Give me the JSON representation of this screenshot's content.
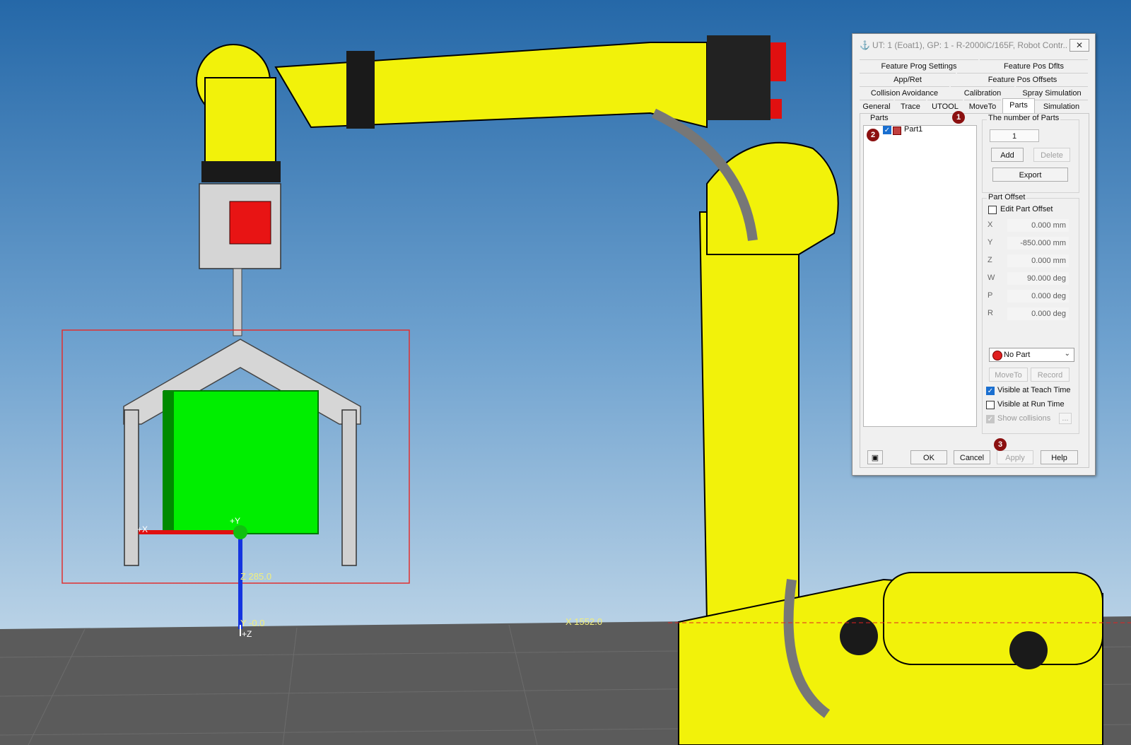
{
  "scene": {
    "labels": {
      "z_dim": "Z 285.0",
      "y_dim": "Y -0.0",
      "x_dim": "X 1552.0",
      "axis_plus_y": "+Y",
      "axis_plus_x": "+X",
      "axis_plus_z": "+Z"
    }
  },
  "dialog": {
    "title": "UT: 1  (Eoat1), GP: 1 - R-2000iC/165F, Robot Contr...",
    "close_label": "✕",
    "tabs": {
      "row1": [
        "Feature Prog Settings",
        "Feature Pos Dflts"
      ],
      "row2": [
        "App/Ret",
        "Feature Pos Offsets"
      ],
      "row3": [
        "Collision Avoidance",
        "Calibration",
        "Spray Simulation"
      ],
      "row4": [
        "General",
        "Trace",
        "UTOOL",
        "MoveTo",
        "Parts",
        "Simulation"
      ]
    },
    "parts_group_label": "Parts",
    "part_item": "Part1",
    "number_of_parts_label": "The number of Parts",
    "number_of_parts_value": "1",
    "add_label": "Add",
    "delete_label": "Delete",
    "export_label": "Export",
    "part_offset_label": "Part Offset",
    "edit_part_offset_label": "Edit Part Offset",
    "offsets": [
      {
        "label": "X",
        "value": "0.000 mm"
      },
      {
        "label": "Y",
        "value": "-850.000 mm"
      },
      {
        "label": "Z",
        "value": "0.000 mm"
      },
      {
        "label": "W",
        "value": "90.000 deg"
      },
      {
        "label": "P",
        "value": "0.000 deg"
      },
      {
        "label": "R",
        "value": "0.000 deg"
      }
    ],
    "no_part_label": "No Part",
    "moveto_label": "MoveTo",
    "record_label": "Record",
    "visible_teach_label": "Visible at Teach Time",
    "visible_run_label": "Visible at Run Time",
    "show_collisions_label": "Show collisions",
    "ellipsis_label": "...",
    "ok_label": "OK",
    "cancel_label": "Cancel",
    "apply_label": "Apply",
    "help_label": "Help",
    "badges": [
      "1",
      "2",
      "3"
    ]
  },
  "colors": {
    "robot_yellow": "#f2f20a",
    "part_green": "#00ee00",
    "sky_top": "#2a6aa9",
    "floor_gray": "#5a5a5a",
    "selection_red": "#e03030",
    "badge_red": "#8b1010"
  },
  "icons": {
    "title": "robot-tool-icon",
    "part": "part-cube-icon",
    "lock": "lock-icon",
    "no_part": "no-part-icon",
    "dropdown": "chevron-down-icon"
  }
}
